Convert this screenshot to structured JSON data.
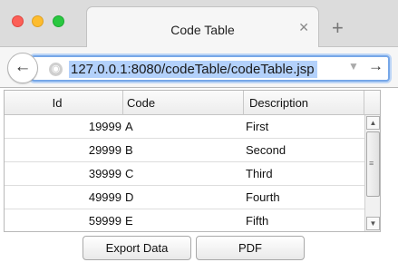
{
  "window": {
    "tab_title": "Code Table",
    "tab_close_glyph": "✕",
    "new_tab_glyph": "+"
  },
  "address_bar": {
    "url": "127.0.0.1:8080/codeTable/codeTable.jsp",
    "back_glyph": "←",
    "go_glyph": "→",
    "dropdown_glyph": "▼",
    "page_icon": "globe-icon",
    "focused": true
  },
  "table": {
    "columns": [
      "Id",
      "Code",
      "Description"
    ],
    "rows": [
      {
        "id": "19999",
        "code": "A",
        "description": "First"
      },
      {
        "id": "29999",
        "code": "B",
        "description": "Second"
      },
      {
        "id": "39999",
        "code": "C",
        "description": "Third"
      },
      {
        "id": "49999",
        "code": "D",
        "description": "Fourth"
      },
      {
        "id": "59999",
        "code": "E",
        "description": "Fifth"
      }
    ]
  },
  "actions": {
    "export_label": "Export Data",
    "pdf_label": "PDF"
  },
  "colors": {
    "close": "#fc5f57",
    "minimize": "#fdbc2e",
    "maximize": "#29c840",
    "url_focus": "#76a7e8",
    "url_selection": "#b3d1fb"
  }
}
